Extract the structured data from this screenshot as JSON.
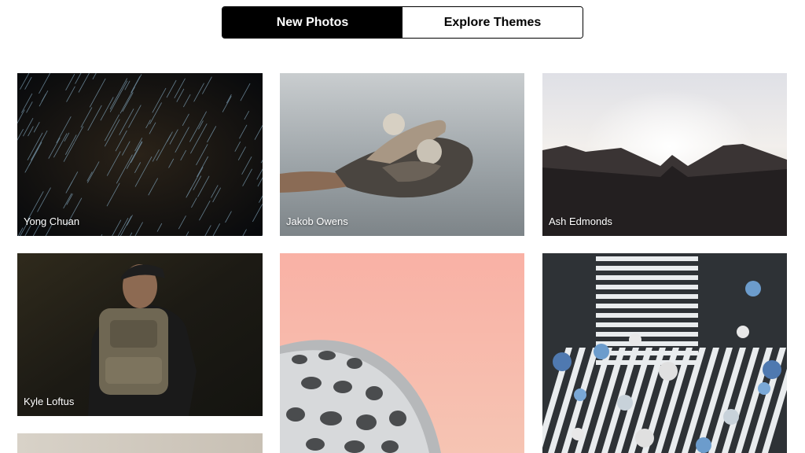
{
  "tabs": [
    {
      "label": "New Photos",
      "active": true
    },
    {
      "label": "Explore Themes",
      "active": false
    }
  ],
  "photos": [
    {
      "author": "Yong Chuan",
      "subject": "star trails night sky"
    },
    {
      "author": "Jakob Owens",
      "subject": "hand holding driftwood and shells"
    },
    {
      "author": "Ash Edmonds",
      "subject": "mountain silhouette at sunrise"
    },
    {
      "author": "Kyle Loftus",
      "subject": "man with backpack in forest"
    },
    {
      "author": "",
      "subject": "spherical building against pink sky"
    },
    {
      "author": "",
      "subject": "aerial crosswalk with umbrellas"
    },
    {
      "author": "",
      "subject": "partially visible photo"
    }
  ],
  "colors": {
    "active_tab_bg": "#000000",
    "active_tab_text": "#ffffff",
    "page_bg": "#ffffff"
  }
}
